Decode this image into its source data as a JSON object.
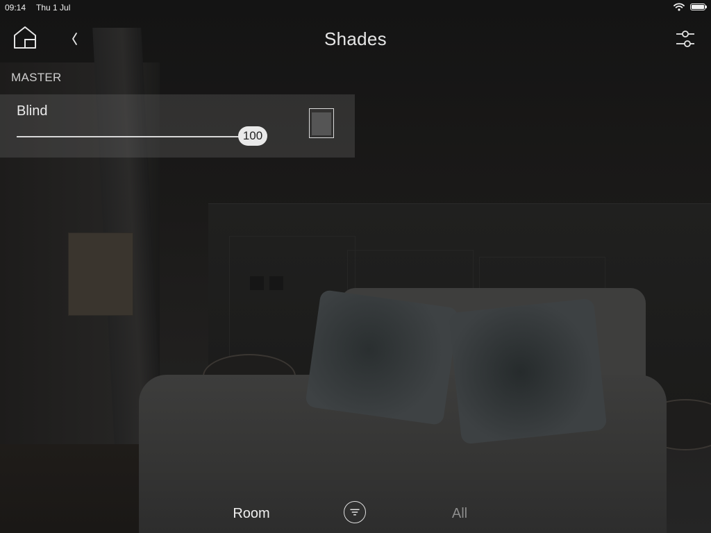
{
  "status_bar": {
    "time": "09:14",
    "date": "Thu 1 Jul"
  },
  "header": {
    "title": "Shades",
    "home_icon": "home-icon",
    "back_icon": "chevron-left-icon",
    "settings_icon": "sliders-icon"
  },
  "master": {
    "section_label": "MASTER",
    "shade": {
      "name": "Blind",
      "level": 100,
      "level_max": 100,
      "level_label": "100",
      "toggle_icon": "blind-icon"
    }
  },
  "bottom_nav": {
    "room_label": "Room",
    "filter_icon": "filter-icon",
    "all_label": "All",
    "active": "Room"
  },
  "colors": {
    "text_primary": "#e8e8e8",
    "text_inactive": "#8d8d8d",
    "card_bg": "rgba(120,120,120,0.28)",
    "slider_thumb": "#e9e9e9"
  }
}
